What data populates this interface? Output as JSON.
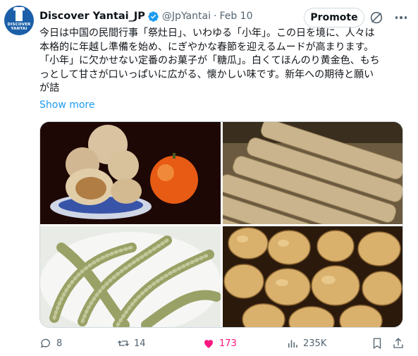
{
  "author": {
    "name": "Discover Yantai_JP",
    "handle": "@JpYantai",
    "separator": "·",
    "date": "Feb 10",
    "avatar_text": "DISCOVER\nYANTAI"
  },
  "buttons": {
    "promote_label": "Promote"
  },
  "tweet": {
    "text": "今日は中国の民間行事「祭灶日」、いわゆる「小年」。この日を境に、人々は\n本格的に年越し準備を始め、にぎやかな春節を迎えるムードが高まります。\n「小年」に欠かせない定番のお菓子が「糖瓜」。白くてほんのり黄金色、もち\nっとして甘さが口いっぱいに広がる、懐かしい味です。新年への期待と願い\nが詰",
    "show_more": "Show more"
  },
  "media": [
    {
      "name": "candy-bowl-photo",
      "icon": "photo"
    },
    {
      "name": "sesame-sticks-photo",
      "icon": "photo"
    },
    {
      "name": "sesame-candy-plate-photo",
      "icon": "photo"
    },
    {
      "name": "melon-candy-pile-photo",
      "icon": "photo"
    }
  ],
  "actions": {
    "replies": "8",
    "reposts": "14",
    "likes": "173",
    "views": "235K"
  },
  "colors": {
    "accent": "#1d9bf0",
    "like": "#f91880",
    "muted": "#536471",
    "verified": "#1d9bf0"
  }
}
